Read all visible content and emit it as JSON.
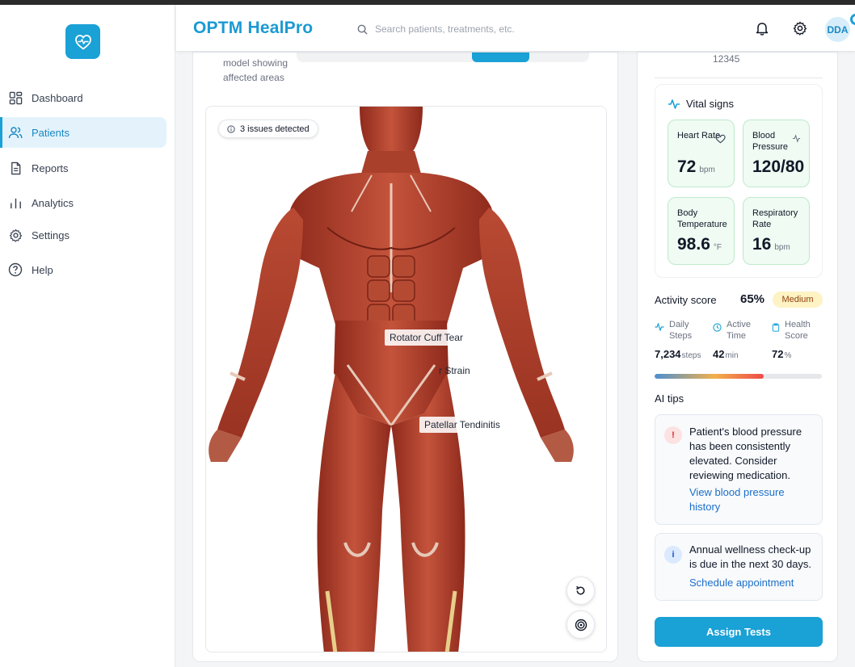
{
  "app": {
    "brand": "OPTM HealPro"
  },
  "search": {
    "placeholder": "Search patients, treatments, etc."
  },
  "header": {
    "avatar_initials": "DDA"
  },
  "sidebar": {
    "items": [
      {
        "label": "Dashboard",
        "icon": "dashboard-icon",
        "active": false
      },
      {
        "label": "Patients",
        "icon": "users-icon",
        "active": true
      },
      {
        "label": "Reports",
        "icon": "document-icon",
        "active": false
      },
      {
        "label": "Analytics",
        "icon": "bar-chart-icon",
        "active": false
      },
      {
        "label": "Settings",
        "icon": "gear-icon",
        "active": false
      },
      {
        "label": "Help",
        "icon": "help-icon",
        "active": false
      }
    ]
  },
  "model_view": {
    "description": "model showing affected areas",
    "issues_badge": "3 issues detected",
    "injuries": [
      "Rotator Cuff Tear",
      "r Strain",
      "Patellar Tendinitis"
    ]
  },
  "patient": {
    "id_fragment": "12345"
  },
  "vitals": {
    "title": "Vital signs",
    "heart_rate": {
      "label": "Heart Rate",
      "value": "72",
      "unit": "bpm"
    },
    "blood_pressure": {
      "label": "Blood Pressure",
      "value": "120/80"
    },
    "body_temperature": {
      "label": "Body Temperature",
      "value": "98.6",
      "unit": "°F"
    },
    "respiratory_rate": {
      "label": "Respiratory Rate",
      "value": "16",
      "unit": "bpm"
    }
  },
  "activity": {
    "label": "Activity score",
    "score": "65%",
    "level": "Medium",
    "progress_fraction": 0.65,
    "daily_steps": {
      "label": "Daily Steps",
      "value": "7,234",
      "unit": "steps"
    },
    "active_time": {
      "label": "Active Time",
      "value": "42",
      "unit": "min"
    },
    "health_score": {
      "label": "Health Score",
      "value": "72",
      "unit": "%"
    }
  },
  "ai_tips": {
    "title": "AI tips",
    "tips": [
      {
        "text": "Patient's blood pressure has been consistently elevated. Consider reviewing medication.",
        "link": "View blood pressure history",
        "icon": "!"
      },
      {
        "text": "Annual wellness check-up is due in the next 30 days.",
        "link": "Schedule appointment",
        "icon": "i"
      }
    ]
  },
  "actions": {
    "assign_tests": "Assign Tests"
  },
  "colors": {
    "accent": "#1aa1d6",
    "vital_bg": "#effbf3",
    "badge_bg": "#fdf3c4",
    "link": "#1d6fc9"
  }
}
